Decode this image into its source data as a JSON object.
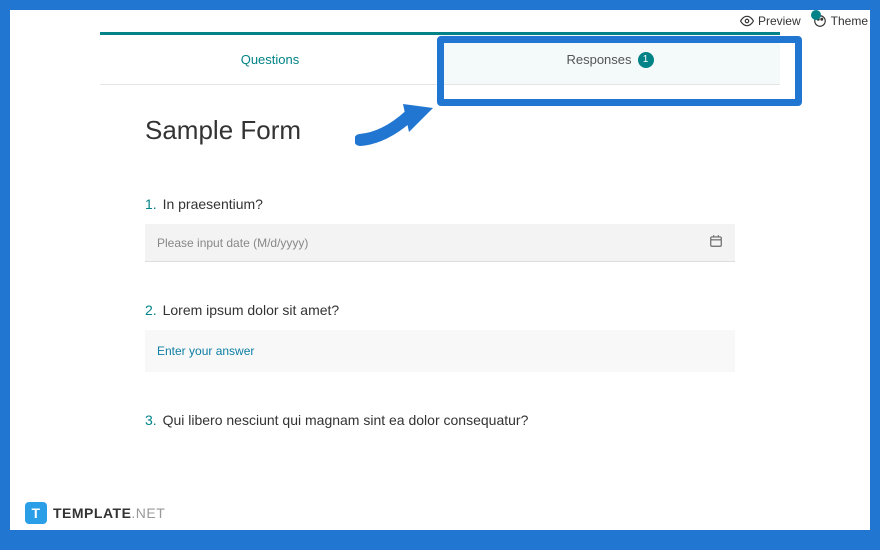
{
  "toolbar": {
    "preview_label": "Preview",
    "theme_label": "Theme"
  },
  "tabs": {
    "questions_label": "Questions",
    "responses_label": "Responses",
    "responses_count": "1"
  },
  "form": {
    "title": "Sample Form",
    "questions": [
      {
        "number": "1.",
        "text": "In praesentium?",
        "placeholder": "Please input date (M/d/yyyy)"
      },
      {
        "number": "2.",
        "text": "Lorem ipsum dolor sit amet?",
        "placeholder": "Enter your answer"
      },
      {
        "number": "3.",
        "text": "Qui libero nesciunt qui magnam sint ea dolor consequatur?"
      }
    ]
  },
  "watermark": {
    "icon_letter": "T",
    "bold": "TEMPLATE",
    "light": ".NET"
  }
}
